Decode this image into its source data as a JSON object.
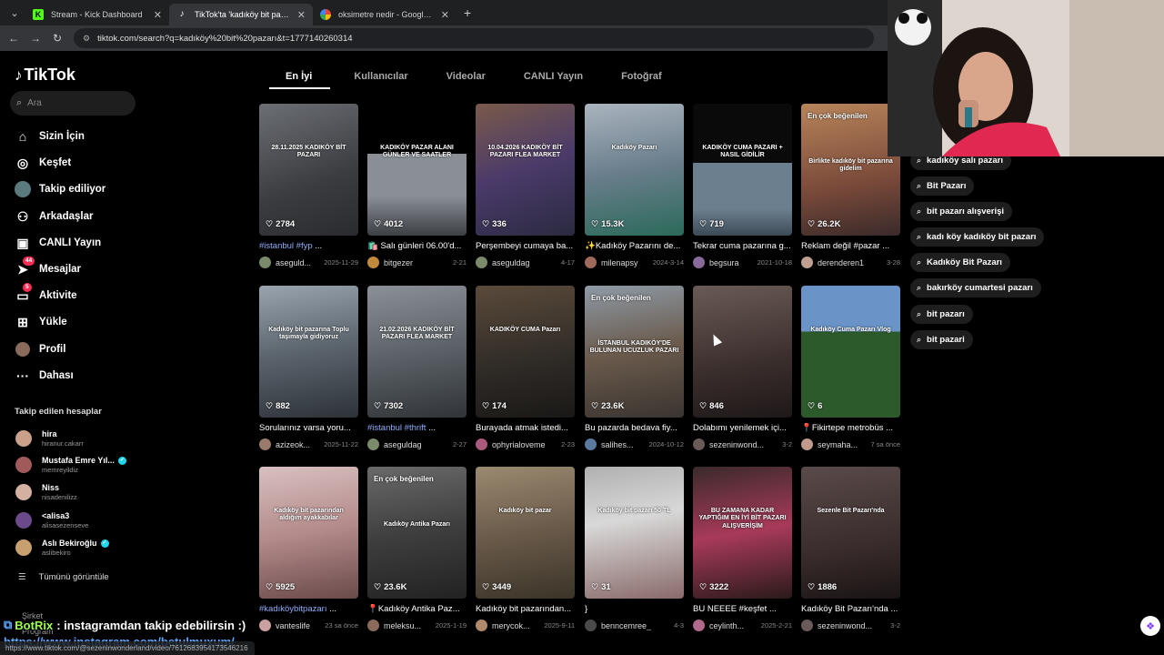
{
  "browser": {
    "tabs": [
      {
        "title": "Stream - Kick Dashboard",
        "color": "#53fc18"
      },
      {
        "title": "TikTok'ta 'kadıköy bit pazarı' bu",
        "color": "#111111"
      },
      {
        "title": "oksimetre nedir - Google'da Ara",
        "color": "#ffffff"
      }
    ],
    "url": "tiktok.com/search?q=kadıköy%20bit%20pazarı&t=1777140260314"
  },
  "sidebar": {
    "logo": "TikTok",
    "search_placeholder": "Ara",
    "nav": [
      {
        "label": "Sizin İçin",
        "icon": "home-icon"
      },
      {
        "label": "Keşfet",
        "icon": "compass-icon"
      },
      {
        "label": "Takip ediliyor",
        "icon": "following-icon"
      },
      {
        "label": "Arkadaşlar",
        "icon": "friends-icon"
      },
      {
        "label": "CANLI Yayın",
        "icon": "live-icon"
      },
      {
        "label": "Mesajlar",
        "icon": "messages-icon",
        "badge": "44"
      },
      {
        "label": "Aktivite",
        "icon": "activity-icon",
        "badge": "5"
      },
      {
        "label": "Yükle",
        "icon": "upload-icon"
      },
      {
        "label": "Profil",
        "icon": "profile-icon"
      },
      {
        "label": "Dahası",
        "icon": "more-icon"
      }
    ],
    "following_heading": "Takip edilen hesaplar",
    "accounts": [
      {
        "name": "hira",
        "username": "hiranur.cakarr",
        "verified": false
      },
      {
        "name": "Mustafa Emre Yıl...",
        "username": "memreyildiz",
        "verified": true
      },
      {
        "name": "Niss",
        "username": "nisadenilizz",
        "verified": false
      },
      {
        "name": "<alisa3",
        "username": "alisasezenseve",
        "verified": false
      },
      {
        "name": "Aslı Bekiroğlu",
        "username": "aslibekiro",
        "verified": true
      }
    ],
    "see_all": "Tümünü görüntüle",
    "company": "Şirket",
    "program": "Program"
  },
  "content_tabs": [
    "En İyi",
    "Kullanıcılar",
    "Videolar",
    "CANLI Yayın",
    "Fotoğraf"
  ],
  "videos": [
    {
      "likes": "2784",
      "overlay": "28.11.2025 KADIKÖY BİT PAZARI",
      "caption_tag": "#istanbul #fyp",
      "caption": " ...",
      "user": "aseguld...",
      "date": "2025-11-29",
      "badge": ""
    },
    {
      "likes": "4012",
      "overlay": "KADIKÖY PAZAR ALANI GÜNLER VE SAATLER",
      "caption_tag": "",
      "caption": "🛍️ Salı günleri 06.00'd...",
      "user": "bitgezer",
      "date": "2-21",
      "badge": ""
    },
    {
      "likes": "336",
      "overlay": "10.04.2026 KADIKÖY BİT PAZARI FLEA MARKET",
      "caption_tag": "",
      "caption": "Perşembeyi cumaya ba...",
      "user": "aseguldag",
      "date": "4-17",
      "badge": ""
    },
    {
      "likes": "15.3K",
      "overlay": "Kadıköy Pazarı",
      "caption_tag": "",
      "caption": "✨Kadıköy Pazarını de...",
      "user": "milenapsy",
      "date": "2024-3-14",
      "badge": ""
    },
    {
      "likes": "719",
      "overlay": "KADIKÖY CUMA PAZARI + NASIL GİDİLİR",
      "caption_tag": "",
      "caption": "Tekrar cuma pazarına g...",
      "user": "begsura",
      "date": "2021-10-18",
      "badge": ""
    },
    {
      "likes": "26.2K",
      "overlay": "Birlikte kadıköy bit pazarına gidelim",
      "caption_tag": "",
      "caption": "Reklam değil #pazar ...",
      "user": "derenderen1",
      "date": "3-28",
      "badge": "En çok beğenilen"
    },
    {
      "likes": "882",
      "overlay": "Kadıköy bit pazarına Toplu taşımayla gidiyoruz",
      "caption_tag": "",
      "caption": "Sorularınız varsa yoru...",
      "user": "azizeok...",
      "date": "2025-11-22",
      "badge": ""
    },
    {
      "likes": "7302",
      "overlay": "21.02.2026 KADIKÖY BİT PAZARI FLEA MARKET",
      "caption_tag": "#istanbul #thrift",
      "caption": " ...",
      "user": "aseguldag",
      "date": "2-27",
      "badge": ""
    },
    {
      "likes": "174",
      "overlay": "KADIKÖY CUMA Pazarı",
      "caption_tag": "",
      "caption": "Burayada atmak istedi...",
      "user": "ophyrialoveme",
      "date": "2-23",
      "badge": ""
    },
    {
      "likes": "23.6K",
      "overlay": "İSTANBUL KADIKÖY'DE BULUNAN UCUZLUK PAZARI",
      "caption_tag": "",
      "caption": "Bu pazarda bedava fiy...",
      "user": "salihes...",
      "date": "2024-10-12",
      "badge": "En çok beğenilen"
    },
    {
      "likes": "846",
      "overlay": "",
      "caption_tag": "",
      "caption": "Dolabımı yenilemek içi...",
      "user": "sezeninwond...",
      "date": "3-2",
      "badge": ""
    },
    {
      "likes": "6",
      "overlay": "Kadıköy Cuma Pazarı Vlog",
      "caption_tag": "",
      "caption": "📍Fikirtepe metrobüs ...",
      "user": "seymaha...",
      "date": "7 sa önce",
      "badge": ""
    },
    {
      "likes": "5925",
      "overlay": "Kadıköy bit pazarından aldığım ayakkabılar",
      "caption_tag": "#kadıköybitpazarı",
      "caption": " ...",
      "user": "vanteslife",
      "date": "23 sa önce",
      "badge": ""
    },
    {
      "likes": "23.6K",
      "overlay": "Kadıköy Antika Pazarı",
      "caption_tag": "",
      "caption": "📍Kadıköy Antika Paz...",
      "user": "meleksu...",
      "date": "2025-1-19",
      "badge": "En çok beğenilen"
    },
    {
      "likes": "3449",
      "overlay": "Kadıköy bit pazar",
      "caption_tag": "",
      "caption": "Kadıköy bit pazarından...",
      "user": "merycok...",
      "date": "2025-9-11",
      "badge": ""
    },
    {
      "likes": "31",
      "overlay": "Kadıköy bit pazarı 50 TL",
      "caption_tag": "",
      "caption": "}",
      "user": "benncemree_",
      "date": "4-3",
      "badge": ""
    },
    {
      "likes": "3222",
      "overlay": "BU ZAMANA KADAR YAPTIĞIM EN İYİ BİT PAZARI ALIŞVERİŞİM",
      "caption_tag": "",
      "caption": "BU NEEEE #keşfet ...",
      "user": "ceylinth...",
      "date": "2025-2-21",
      "badge": ""
    },
    {
      "likes": "1886",
      "overlay": "Sezenle Bit Pazarı'nda",
      "caption_tag": "",
      "caption": "Kadıköy Bit Pazarı'nda ...",
      "user": "sezeninwond...",
      "date": "3-2",
      "badge": ""
    }
  ],
  "related_searches": [
    "kadıköy salı pazarı",
    "Bit Pazarı",
    "bit pazarı alışverişi",
    "kadı köy kadıköy bit pazarı",
    "Kadıköy Bit Pazarı",
    "bakırköy cumartesi pazarı",
    "bit pazarı",
    "bit pazari"
  ],
  "chat": {
    "bot": "BotRix",
    "message": ": instagramdan takip edebilirsin :)",
    "link": "https://www.instagram.com/betulmuxum/"
  },
  "statusbar": "https://www.tiktok.com/@sezeninwonderland/video/7612683954173546216"
}
